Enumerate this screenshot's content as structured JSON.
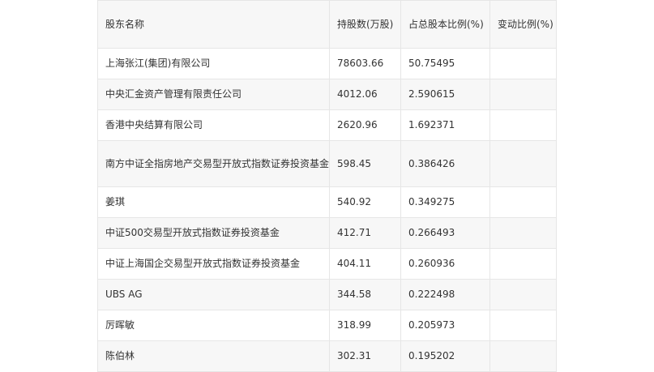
{
  "table": {
    "headers": [
      "股东名称",
      "持股数(万股)",
      "占总股本比例(%)",
      "变动比例(%)"
    ],
    "rows": [
      [
        "上海张江(集团)有限公司",
        "78603.66",
        "50.75495",
        ""
      ],
      [
        "中央汇金资产管理有限责任公司",
        "4012.06",
        "2.590615",
        ""
      ],
      [
        "香港中央结算有限公司",
        "2620.96",
        "1.692371",
        ""
      ],
      [
        "南方中证全指房地产交易型开放式指数证券投资基金",
        "598.45",
        "0.386426",
        ""
      ],
      [
        "姜琪",
        "540.92",
        "0.349275",
        ""
      ],
      [
        "中证500交易型开放式指数证券投资基金",
        "412.71",
        "0.266493",
        ""
      ],
      [
        "中证上海国企交易型开放式指数证券投资基金",
        "404.11",
        "0.260936",
        ""
      ],
      [
        "UBS AG",
        "344.58",
        "0.222498",
        ""
      ],
      [
        "厉晖敏",
        "318.99",
        "0.205973",
        ""
      ],
      [
        "陈伯林",
        "302.31",
        "0.195202",
        ""
      ]
    ]
  }
}
